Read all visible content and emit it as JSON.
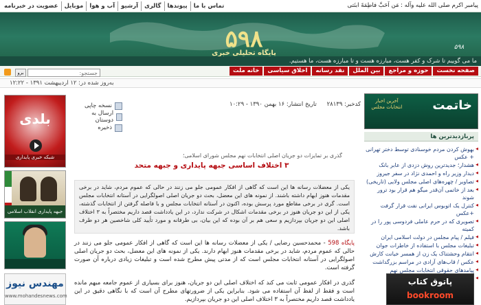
{
  "top_nav": {
    "links": [
      "تماس با ما",
      "پیوندها",
      "گالری",
      "آرشیو",
      "آب و هوا",
      "موبایل",
      "عضویت در خبرنامه"
    ],
    "hadith": "پیامبر اکرم صلی الله علیه وآله :    مَن اَحَبَّ فاطِمَةَ ابنَتی"
  },
  "banner": {
    "logo_number": "۵۹۸",
    "logo_subtitle": "پایگاه تحلیلی خبری",
    "emblem_text": "۵۹۸"
  },
  "tagline": "ما می گوییم تا شرک و کفر هست، مبارزه هست و تا مبارزه هست، ما هستیم.",
  "menu": [
    "صفحه نخست",
    "حوزه و مراجع",
    "بین الملل",
    "نقد رسانه",
    "اخلاق سیاسی",
    "خانه ملت"
  ],
  "search": {
    "placeholder": "جستجو:",
    "button": "برو"
  },
  "datebar": {
    "text": "به‌روز شده در: ۱۲ اردیبهشت ۱۳۹۱ - ۱۲:۲۲"
  },
  "tools": [
    "نسخه چاپی",
    "ارسال به دوستان",
    "ذخیره"
  ],
  "news_info": {
    "code": "کدخبر: ۲۸۱۳۹",
    "published": "تاریخ انتشار: ۱۶ بهمن ۱۳۹۰ - ۱۰:۲۹"
  },
  "article": {
    "subtitle": "گذری بر تمایزات دو جریان اصلی انتخابات نهم مجلس شورای اسلامی؛",
    "headline": "۳ اختلاف اساسی جبهه پایداری و جبهه متحد",
    "lead": "یکی از معضلات رسانه ها این است که گاهی از افکار عمومی جلو می زنند در حالی که عموم مردم، شاید در برخی مقدمات هنوز ابهام داشته باشند. از نمونه های این معضل، بحث دو جریان اصلی اصولگرایی در آستانه انتخابات مجلس است. گری در برخی مقاطع مورد پرسش بوده، اکنون در آستانه انتخابات مجلس و با فاصله گرفتن از انتخابات گذشته، یکی از این دو جریان هنوز در برخی مقدمات اشکال در شرکت ندارد، در این یادداشت قصد داریم مختصراً به ۳ اختلاف اصلی این دو جریان بپردازیم و سعی هم بر آن بوده که این بیان، بی طرفانه و مورد تأیید کلی شاخصین هر دو طرف باشد.",
    "body_source": "پایگاه 598",
    "body_p1": " - محمدحسین رضایی / یکی از معضلات رسانه ها این است که گاهی از افکار عمومی جلو می زنند در حالی که عموم مردم، شاید در برخی مقدمات هنوز ابهام دارند. یکی از نمونه های این معضل، بحث دو جریان اصلی اصولگرایی در آستانه انتخابات مجلس است که از مدتی پیش مطرح شده است و تبلیغات زیادی درباره آن صورت گرفته است.",
    "body_p2": "گذری در افکار عمومی ثابت می کند که اختلاف اصلی این دو جریان، هنوز برای بسیاری از عموم جامعه مبهم مانده است و فقط از لفظ آن استفاده می شود. بنابراین یکی از ضرورتهای مطرح آن است که با نگاهی دقیق در این یادداشت قصد داریم مختصراً به ۳ اختلاف اصلی این دو جریان بپردازیم."
  },
  "left_ads": {
    "baladi": {
      "title": "بلدی",
      "caption": "شبکه خبری پایداری"
    },
    "khamenei": {
      "caption": "جبهه پایداری انقلاب اسلامی"
    },
    "mohandes": {
      "title": "مهندس نیوز",
      "url": "www.mohandesnews.com"
    }
  },
  "right": {
    "khatnet": {
      "title": "خاتمت",
      "subtitle": "آخرین اخبار انتخابات مجلس"
    },
    "popular_heading": "پربازدیدترین ها",
    "popular": [
      "بهوش کردن مردم خوسنادی توسط دختر تهرانی + عکس",
      "هشدار؛ جدیدترین روش دزدی از عابر بانک",
      "دیدار وزیر راه و احمدی نژاد در سفر جیروز",
      "تصاویر / چهره‌های اصلی مجلس ولایی (تاریخی)",
      "بعد از خاتمی آن‌قدر میگو هم قرار بود ترور شوند",
      "کنترل یک اتوبوس ایرانی نفت قرار گرفت +عکس",
      "تصویری که در حرم عاملی فردوسی پور را در کمیته",
      "فیلم / پیام مجلس در دولت اسلامی ایران",
      "تبلیغات مجلس با استفاده از خاطرات جوان",
      "انتقام وحشتناک یک زن از همسر خیانت کارش",
      "عکس / قاب‌های آزادی در مراسم بزرگداشت",
      "پیامدهای حقوقی انتخابات مجلس نهم",
      "قیمت روز طلا و ارز/ امروز 91/02/11"
    ],
    "bookroom": {
      "title": "پاتوق کتاب",
      "brand": "bookroom"
    }
  }
}
